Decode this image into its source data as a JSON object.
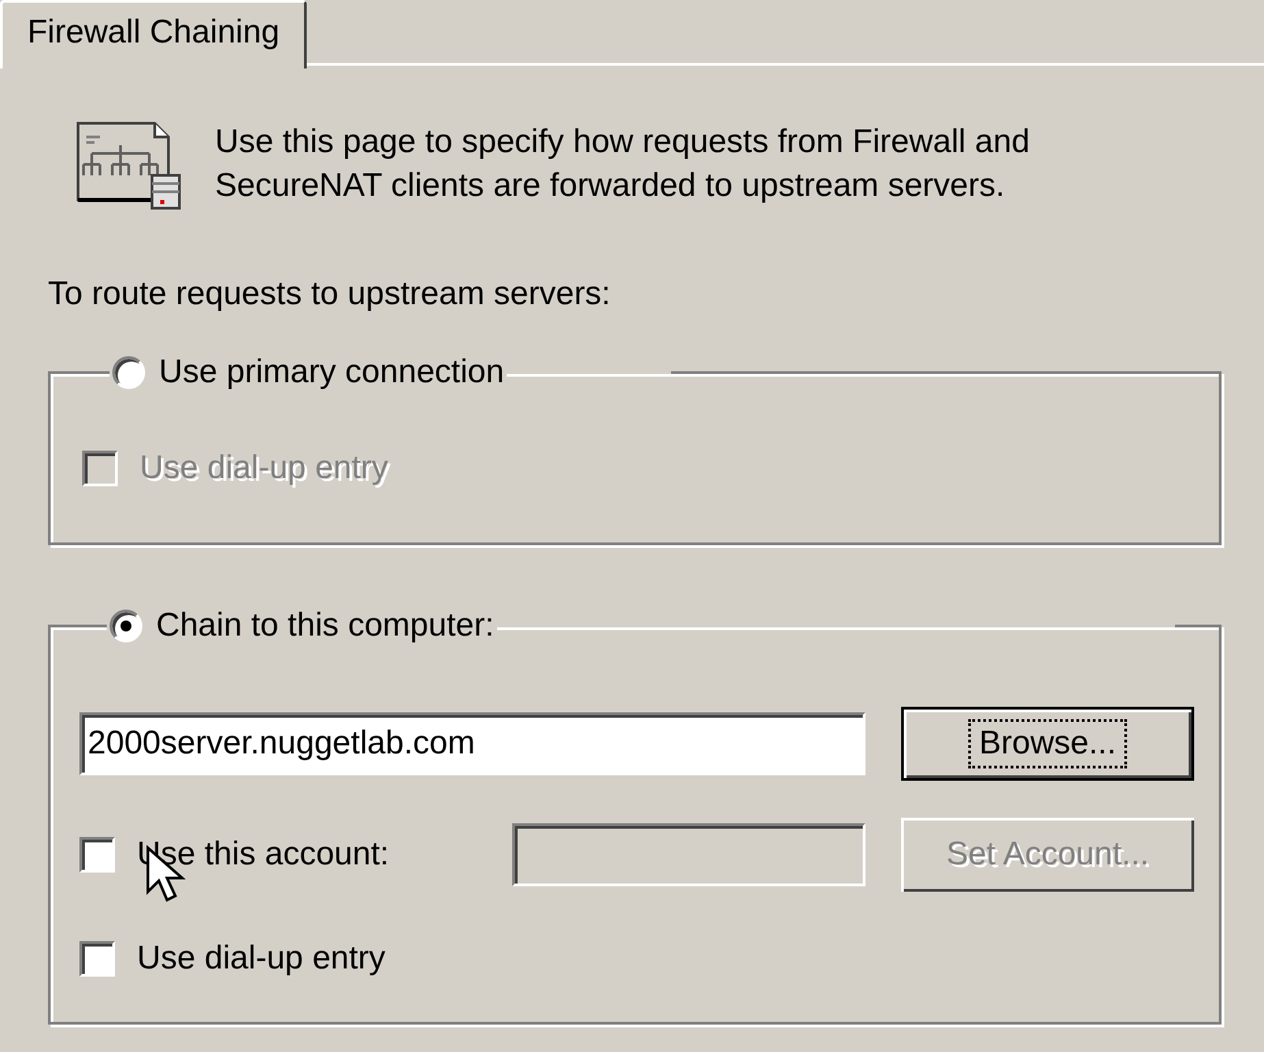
{
  "tab": {
    "label": "Firewall Chaining",
    "selected": true
  },
  "intro": "Use this page to specify how requests from Firewall and SecureNAT clients are forwarded to upstream servers.",
  "route_label": "To route requests to upstream servers:",
  "primary_group": {
    "radio": {
      "label": "Use primary connection",
      "selected": false
    },
    "dialup": {
      "label": "Use dial-up entry",
      "checked": false,
      "disabled": true
    }
  },
  "chain_group": {
    "radio": {
      "label": "Chain to this computer:",
      "selected": true
    },
    "computer_field": {
      "value": "2000server.nuggetlab.com"
    },
    "browse_button": {
      "label": "Browse...",
      "focused": true
    },
    "account": {
      "label": "Use this account:",
      "checked": false,
      "disabled": false
    },
    "account_field": {
      "disabled": true
    },
    "set_account_button": {
      "label": "Set Account...",
      "disabled": true
    },
    "dialup": {
      "label": "Use dial-up entry",
      "checked": false,
      "disabled": false
    }
  }
}
